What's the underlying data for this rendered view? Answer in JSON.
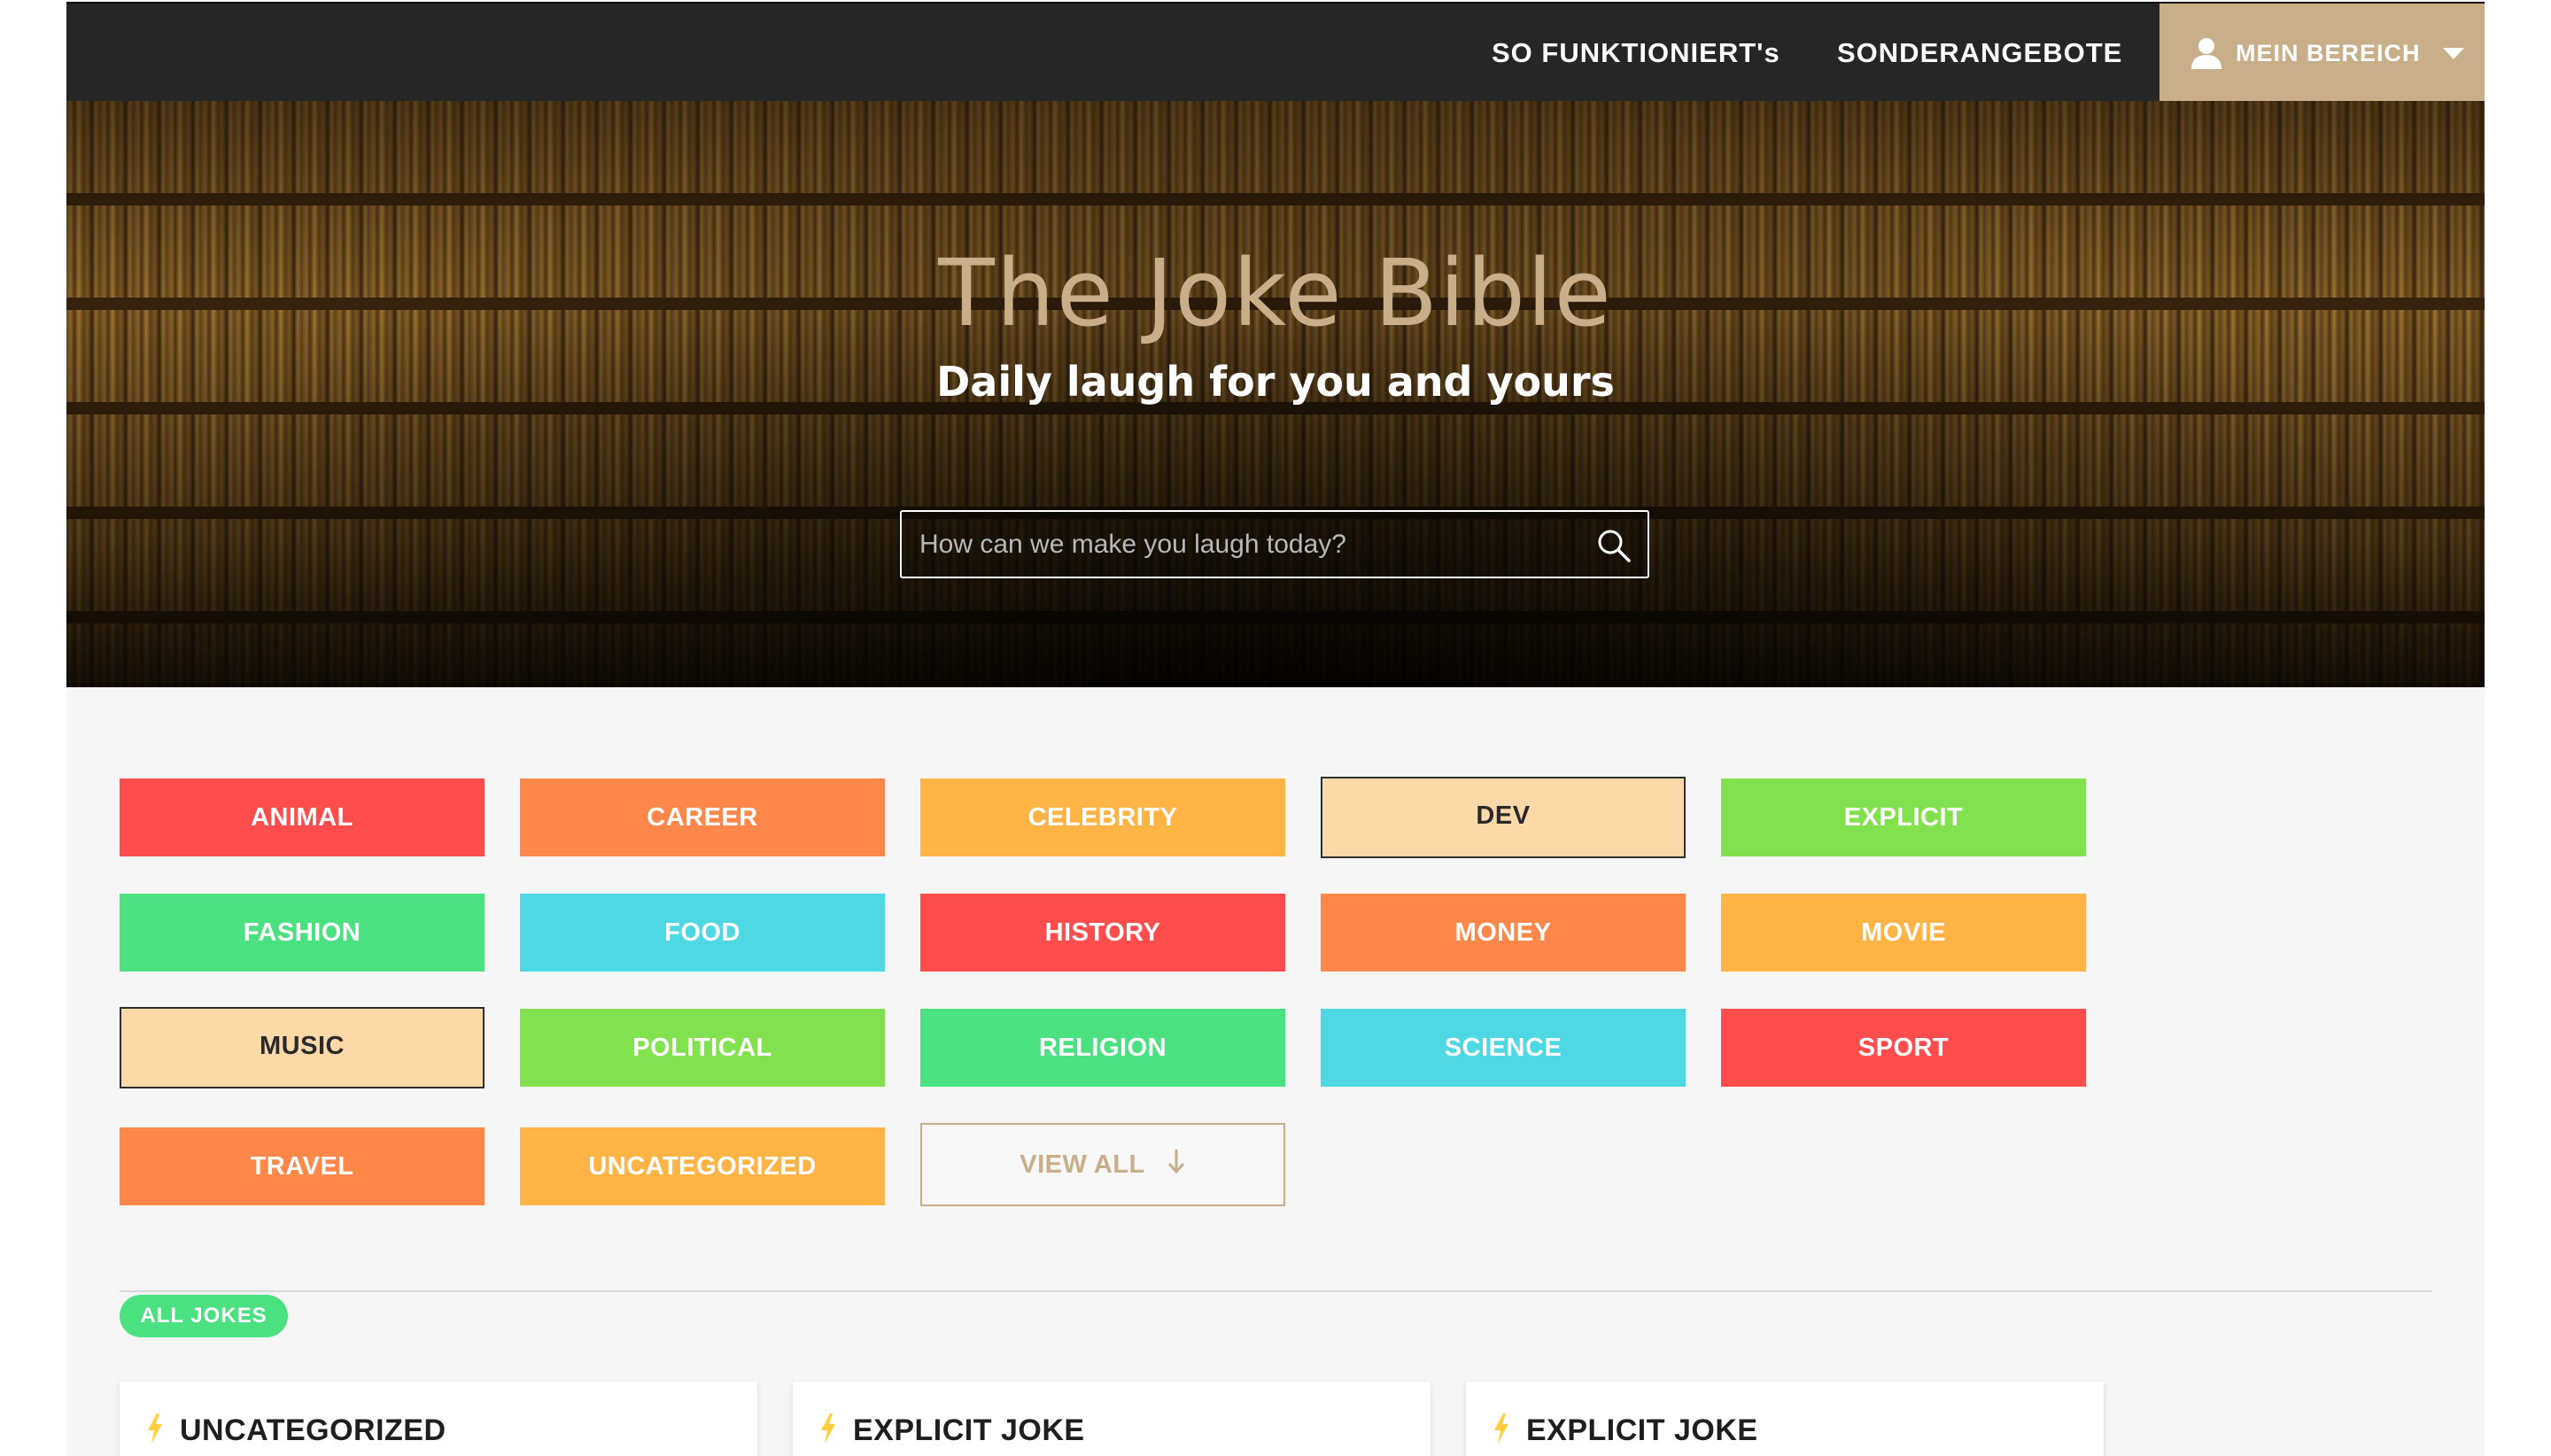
{
  "nav": {
    "how_it_works": "SO FUNKTIONIERT's",
    "offers": "SONDERANGEBOTE",
    "account": "MEIN BEREICH"
  },
  "hero": {
    "title": "The Joke Bible",
    "subtitle": "Daily laugh for you and yours",
    "search_placeholder": "How can we make you laugh today?"
  },
  "categories": [
    {
      "label": "ANIMAL",
      "color": "#ff4c4c"
    },
    {
      "label": "CAREER",
      "color": "#ff874a"
    },
    {
      "label": "CELEBRITY",
      "color": "#ffb445"
    },
    {
      "label": "DEV",
      "color": "#fdd9a8"
    },
    {
      "label": "EXPLICIT",
      "color": "#82e14f"
    },
    {
      "label": "FASHION",
      "color": "#4be080"
    },
    {
      "label": "FOOD",
      "color": "#4dd8e3"
    },
    {
      "label": "HISTORY",
      "color": "#ff4c4c"
    },
    {
      "label": "MONEY",
      "color": "#ff874a"
    },
    {
      "label": "MOVIE",
      "color": "#ffb445"
    },
    {
      "label": "MUSIC",
      "color": "#fdd9a8"
    },
    {
      "label": "POLITICAL",
      "color": "#82e14f"
    },
    {
      "label": "RELIGION",
      "color": "#4be080"
    },
    {
      "label": "SCIENCE",
      "color": "#4dd8e3"
    },
    {
      "label": "SPORT",
      "color": "#ff4c4c"
    },
    {
      "label": "TRAVEL",
      "color": "#ff874a"
    },
    {
      "label": "UNCATEGORIZED",
      "color": "#ffb445"
    }
  ],
  "view_all": "VIEW ALL",
  "section_badge": "ALL JOKES",
  "jokes": [
    {
      "title": "UNCATEGORIZED"
    },
    {
      "title": "EXPLICIT JOKE"
    },
    {
      "title": "EXPLICIT JOKE"
    }
  ],
  "colors": {
    "accent_gold": "#c9ae8a",
    "nav_bg": "#262626",
    "badge_green": "#4be080"
  }
}
